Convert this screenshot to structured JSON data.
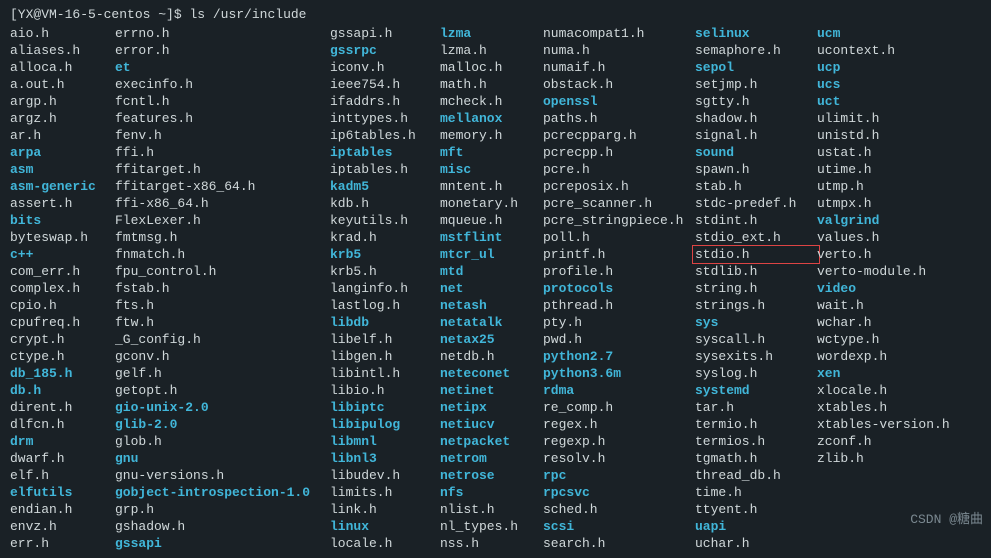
{
  "prompt": {
    "userhost": "[YX@VM-16-5-centos ~]$",
    "command": "ls /usr/include"
  },
  "cols": [
    [
      {
        "name": "aio.h",
        "t": "f"
      },
      {
        "name": "aliases.h",
        "t": "f"
      },
      {
        "name": "alloca.h",
        "t": "f"
      },
      {
        "name": "a.out.h",
        "t": "f"
      },
      {
        "name": "argp.h",
        "t": "f"
      },
      {
        "name": "argz.h",
        "t": "f"
      },
      {
        "name": "ar.h",
        "t": "f"
      },
      {
        "name": "arpa",
        "t": "d"
      },
      {
        "name": "asm",
        "t": "d"
      },
      {
        "name": "asm-generic",
        "t": "d"
      },
      {
        "name": "assert.h",
        "t": "f"
      },
      {
        "name": "bits",
        "t": "d"
      },
      {
        "name": "byteswap.h",
        "t": "f"
      },
      {
        "name": "c++",
        "t": "d"
      },
      {
        "name": "com_err.h",
        "t": "f"
      },
      {
        "name": "complex.h",
        "t": "f"
      },
      {
        "name": "cpio.h",
        "t": "f"
      },
      {
        "name": "cpufreq.h",
        "t": "f"
      },
      {
        "name": "crypt.h",
        "t": "f"
      },
      {
        "name": "ctype.h",
        "t": "f"
      },
      {
        "name": "db_185.h",
        "t": "d"
      },
      {
        "name": "db.h",
        "t": "d"
      },
      {
        "name": "dirent.h",
        "t": "f"
      },
      {
        "name": "dlfcn.h",
        "t": "f"
      },
      {
        "name": "drm",
        "t": "d"
      },
      {
        "name": "dwarf.h",
        "t": "f"
      },
      {
        "name": "elf.h",
        "t": "f"
      },
      {
        "name": "elfutils",
        "t": "d"
      },
      {
        "name": "endian.h",
        "t": "f"
      },
      {
        "name": "envz.h",
        "t": "f"
      },
      {
        "name": "err.h",
        "t": "f"
      }
    ],
    [
      {
        "name": "errno.h",
        "t": "f"
      },
      {
        "name": "error.h",
        "t": "f"
      },
      {
        "name": "et",
        "t": "d"
      },
      {
        "name": "execinfo.h",
        "t": "f"
      },
      {
        "name": "fcntl.h",
        "t": "f"
      },
      {
        "name": "features.h",
        "t": "f"
      },
      {
        "name": "fenv.h",
        "t": "f"
      },
      {
        "name": "ffi.h",
        "t": "f"
      },
      {
        "name": "ffitarget.h",
        "t": "f"
      },
      {
        "name": "ffitarget-x86_64.h",
        "t": "f"
      },
      {
        "name": "ffi-x86_64.h",
        "t": "f"
      },
      {
        "name": "FlexLexer.h",
        "t": "f"
      },
      {
        "name": "fmtmsg.h",
        "t": "f"
      },
      {
        "name": "fnmatch.h",
        "t": "f"
      },
      {
        "name": "fpu_control.h",
        "t": "f"
      },
      {
        "name": "fstab.h",
        "t": "f"
      },
      {
        "name": "fts.h",
        "t": "f"
      },
      {
        "name": "ftw.h",
        "t": "f"
      },
      {
        "name": "_G_config.h",
        "t": "f"
      },
      {
        "name": "gconv.h",
        "t": "f"
      },
      {
        "name": "gelf.h",
        "t": "f"
      },
      {
        "name": "getopt.h",
        "t": "f"
      },
      {
        "name": "gio-unix-2.0",
        "t": "d"
      },
      {
        "name": "glib-2.0",
        "t": "d"
      },
      {
        "name": "glob.h",
        "t": "f"
      },
      {
        "name": "gnu",
        "t": "d"
      },
      {
        "name": "gnu-versions.h",
        "t": "f"
      },
      {
        "name": "gobject-introspection-1.0",
        "t": "d"
      },
      {
        "name": "grp.h",
        "t": "f"
      },
      {
        "name": "gshadow.h",
        "t": "f"
      },
      {
        "name": "gssapi",
        "t": "d"
      }
    ],
    [
      {
        "name": "gssapi.h",
        "t": "f"
      },
      {
        "name": "gssrpc",
        "t": "d"
      },
      {
        "name": "iconv.h",
        "t": "f"
      },
      {
        "name": "ieee754.h",
        "t": "f"
      },
      {
        "name": "ifaddrs.h",
        "t": "f"
      },
      {
        "name": "inttypes.h",
        "t": "f"
      },
      {
        "name": "ip6tables.h",
        "t": "f"
      },
      {
        "name": "iptables",
        "t": "d"
      },
      {
        "name": "iptables.h",
        "t": "f"
      },
      {
        "name": "kadm5",
        "t": "d"
      },
      {
        "name": "kdb.h",
        "t": "f"
      },
      {
        "name": "keyutils.h",
        "t": "f"
      },
      {
        "name": "krad.h",
        "t": "f"
      },
      {
        "name": "krb5",
        "t": "d"
      },
      {
        "name": "krb5.h",
        "t": "f"
      },
      {
        "name": "langinfo.h",
        "t": "f"
      },
      {
        "name": "lastlog.h",
        "t": "f"
      },
      {
        "name": "libdb",
        "t": "d"
      },
      {
        "name": "libelf.h",
        "t": "f"
      },
      {
        "name": "libgen.h",
        "t": "f"
      },
      {
        "name": "libintl.h",
        "t": "f"
      },
      {
        "name": "libio.h",
        "t": "f"
      },
      {
        "name": "libiptc",
        "t": "d"
      },
      {
        "name": "libipulog",
        "t": "d"
      },
      {
        "name": "libmnl",
        "t": "d"
      },
      {
        "name": "libnl3",
        "t": "d"
      },
      {
        "name": "libudev.h",
        "t": "f"
      },
      {
        "name": "limits.h",
        "t": "f"
      },
      {
        "name": "link.h",
        "t": "f"
      },
      {
        "name": "linux",
        "t": "d"
      },
      {
        "name": "locale.h",
        "t": "f"
      }
    ],
    [
      {
        "name": "lzma",
        "t": "d"
      },
      {
        "name": "lzma.h",
        "t": "f"
      },
      {
        "name": "malloc.h",
        "t": "f"
      },
      {
        "name": "math.h",
        "t": "f"
      },
      {
        "name": "mcheck.h",
        "t": "f"
      },
      {
        "name": "mellanox",
        "t": "d"
      },
      {
        "name": "memory.h",
        "t": "f"
      },
      {
        "name": "mft",
        "t": "d"
      },
      {
        "name": "misc",
        "t": "d"
      },
      {
        "name": "mntent.h",
        "t": "f"
      },
      {
        "name": "monetary.h",
        "t": "f"
      },
      {
        "name": "mqueue.h",
        "t": "f"
      },
      {
        "name": "mstflint",
        "t": "d"
      },
      {
        "name": "mtcr_ul",
        "t": "d"
      },
      {
        "name": "mtd",
        "t": "d"
      },
      {
        "name": "net",
        "t": "d"
      },
      {
        "name": "netash",
        "t": "d"
      },
      {
        "name": "netatalk",
        "t": "d"
      },
      {
        "name": "netax25",
        "t": "d"
      },
      {
        "name": "netdb.h",
        "t": "f"
      },
      {
        "name": "neteconet",
        "t": "d"
      },
      {
        "name": "netinet",
        "t": "d"
      },
      {
        "name": "netipx",
        "t": "d"
      },
      {
        "name": "netiucv",
        "t": "d"
      },
      {
        "name": "netpacket",
        "t": "d"
      },
      {
        "name": "netrom",
        "t": "d"
      },
      {
        "name": "netrose",
        "t": "d"
      },
      {
        "name": "nfs",
        "t": "d"
      },
      {
        "name": "nlist.h",
        "t": "f"
      },
      {
        "name": "nl_types.h",
        "t": "f"
      },
      {
        "name": "nss.h",
        "t": "f"
      }
    ],
    [
      {
        "name": "numacompat1.h",
        "t": "f"
      },
      {
        "name": "numa.h",
        "t": "f"
      },
      {
        "name": "numaif.h",
        "t": "f"
      },
      {
        "name": "obstack.h",
        "t": "f"
      },
      {
        "name": "openssl",
        "t": "d"
      },
      {
        "name": "paths.h",
        "t": "f"
      },
      {
        "name": "pcrecpparg.h",
        "t": "f"
      },
      {
        "name": "pcrecpp.h",
        "t": "f"
      },
      {
        "name": "pcre.h",
        "t": "f"
      },
      {
        "name": "pcreposix.h",
        "t": "f"
      },
      {
        "name": "pcre_scanner.h",
        "t": "f"
      },
      {
        "name": "pcre_stringpiece.h",
        "t": "f"
      },
      {
        "name": "poll.h",
        "t": "f"
      },
      {
        "name": "printf.h",
        "t": "f"
      },
      {
        "name": "profile.h",
        "t": "f"
      },
      {
        "name": "protocols",
        "t": "d"
      },
      {
        "name": "pthread.h",
        "t": "f"
      },
      {
        "name": "pty.h",
        "t": "f"
      },
      {
        "name": "pwd.h",
        "t": "f"
      },
      {
        "name": "python2.7",
        "t": "d"
      },
      {
        "name": "python3.6m",
        "t": "d"
      },
      {
        "name": "rdma",
        "t": "d"
      },
      {
        "name": "re_comp.h",
        "t": "f"
      },
      {
        "name": "regex.h",
        "t": "f"
      },
      {
        "name": "regexp.h",
        "t": "f"
      },
      {
        "name": "resolv.h",
        "t": "f"
      },
      {
        "name": "rpc",
        "t": "d"
      },
      {
        "name": "rpcsvc",
        "t": "d"
      },
      {
        "name": "sched.h",
        "t": "f"
      },
      {
        "name": "scsi",
        "t": "d"
      },
      {
        "name": "search.h",
        "t": "f"
      }
    ],
    [
      {
        "name": "selinux",
        "t": "d"
      },
      {
        "name": "semaphore.h",
        "t": "f"
      },
      {
        "name": "sepol",
        "t": "d"
      },
      {
        "name": "setjmp.h",
        "t": "f"
      },
      {
        "name": "sgtty.h",
        "t": "f"
      },
      {
        "name": "shadow.h",
        "t": "f"
      },
      {
        "name": "signal.h",
        "t": "f"
      },
      {
        "name": "sound",
        "t": "d"
      },
      {
        "name": "spawn.h",
        "t": "f"
      },
      {
        "name": "stab.h",
        "t": "f"
      },
      {
        "name": "stdc-predef.h",
        "t": "f"
      },
      {
        "name": "stdint.h",
        "t": "f"
      },
      {
        "name": "stdio_ext.h",
        "t": "f"
      },
      {
        "name": "stdio.h",
        "t": "f",
        "hl": true
      },
      {
        "name": "stdlib.h",
        "t": "f"
      },
      {
        "name": "string.h",
        "t": "f"
      },
      {
        "name": "strings.h",
        "t": "f"
      },
      {
        "name": "sys",
        "t": "d"
      },
      {
        "name": "syscall.h",
        "t": "f"
      },
      {
        "name": "sysexits.h",
        "t": "f"
      },
      {
        "name": "syslog.h",
        "t": "f"
      },
      {
        "name": "systemd",
        "t": "d"
      },
      {
        "name": "tar.h",
        "t": "f"
      },
      {
        "name": "termio.h",
        "t": "f"
      },
      {
        "name": "termios.h",
        "t": "f"
      },
      {
        "name": "tgmath.h",
        "t": "f"
      },
      {
        "name": "thread_db.h",
        "t": "f"
      },
      {
        "name": "time.h",
        "t": "f"
      },
      {
        "name": "ttyent.h",
        "t": "f"
      },
      {
        "name": "uapi",
        "t": "d"
      },
      {
        "name": "uchar.h",
        "t": "f"
      }
    ],
    [
      {
        "name": "ucm",
        "t": "d"
      },
      {
        "name": "ucontext.h",
        "t": "f"
      },
      {
        "name": "ucp",
        "t": "d"
      },
      {
        "name": "ucs",
        "t": "d"
      },
      {
        "name": "uct",
        "t": "d"
      },
      {
        "name": "ulimit.h",
        "t": "f"
      },
      {
        "name": "unistd.h",
        "t": "f"
      },
      {
        "name": "ustat.h",
        "t": "f"
      },
      {
        "name": "utime.h",
        "t": "f"
      },
      {
        "name": "utmp.h",
        "t": "f"
      },
      {
        "name": "utmpx.h",
        "t": "f"
      },
      {
        "name": "valgrind",
        "t": "d"
      },
      {
        "name": "values.h",
        "t": "f"
      },
      {
        "name": "verto.h",
        "t": "f"
      },
      {
        "name": "verto-module.h",
        "t": "f"
      },
      {
        "name": "video",
        "t": "d"
      },
      {
        "name": "wait.h",
        "t": "f"
      },
      {
        "name": "wchar.h",
        "t": "f"
      },
      {
        "name": "wctype.h",
        "t": "f"
      },
      {
        "name": "wordexp.h",
        "t": "f"
      },
      {
        "name": "xen",
        "t": "d"
      },
      {
        "name": "xlocale.h",
        "t": "f"
      },
      {
        "name": "xtables.h",
        "t": "f"
      },
      {
        "name": "xtables-version.h",
        "t": "f"
      },
      {
        "name": "zconf.h",
        "t": "f"
      },
      {
        "name": "zlib.h",
        "t": "f"
      }
    ]
  ],
  "watermark": "CSDN @糖曲"
}
